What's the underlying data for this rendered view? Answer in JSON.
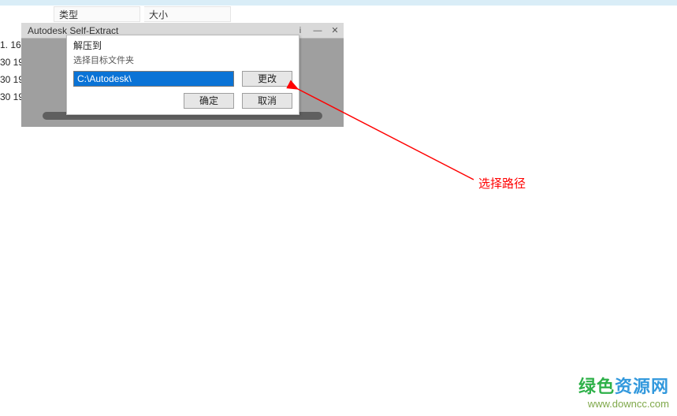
{
  "header": {
    "col_type": "类型",
    "col_size": "大小"
  },
  "left_fragments": {
    "l1": "1. 16:",
    "l2": "30 19",
    "l3": "30 19",
    "l4": "30 19"
  },
  "extractor": {
    "title": "Autodesk Self-Extract",
    "info_icon": "i",
    "min_icon": "—",
    "close_icon": "✕"
  },
  "dialog": {
    "title": "解压到",
    "subtitle": "选择目标文件夹",
    "path_value": "C:\\Autodesk\\",
    "change_label": "更改",
    "ok_label": "确定",
    "cancel_label": "取消"
  },
  "annotation": {
    "text": "选择路径"
  },
  "watermark": {
    "cn_green": "绿色",
    "cn_blue": "资源网",
    "url": "www.downcc.com"
  }
}
